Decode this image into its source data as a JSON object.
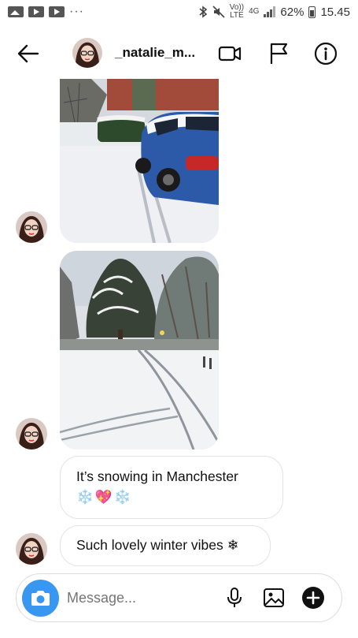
{
  "status_bar": {
    "dots": "···",
    "volte_top": "Vo))",
    "volte_bottom": "LTE",
    "network": "4G",
    "battery": "62%",
    "time": "15.45"
  },
  "header": {
    "username": "_natalie_m..."
  },
  "thread": {
    "messages": [
      {
        "text": "It’s snowing in Manchester",
        "emoji": [
          "❄️",
          "💖",
          "❄️"
        ]
      },
      {
        "text": "Such lovely winter vibes ❄"
      }
    ]
  },
  "composer": {
    "placeholder": "Message..."
  },
  "colors": {
    "accent": "#3897f0",
    "bubble_border": "#e3e3e3"
  },
  "icons": [
    "back-arrow-icon",
    "video-call-icon",
    "flag-icon",
    "info-icon",
    "camera-icon",
    "microphone-icon",
    "gallery-icon",
    "plus-icon"
  ]
}
